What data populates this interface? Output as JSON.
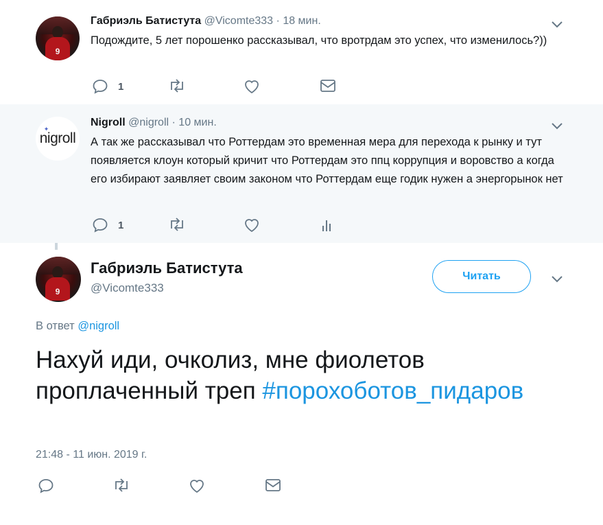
{
  "thread": [
    {
      "author_name": "Габриэль Батистута",
      "author_handle": "@Vicomte333",
      "separator": "·",
      "time_ago": "18 мин.",
      "text": "Подождите, 5 лет порошенко рассказывал, что вротрдам это успех, что изменилось?))",
      "reply_count": "1",
      "avatar_icon": "player-photo-avatar"
    },
    {
      "author_name": "Nigroll",
      "author_handle": "@nigroll",
      "separator": "·",
      "time_ago": "10 мин.",
      "text": "А так же рассказывал что Роттердам это временная мера для перехода к рынку и тут появляется клоун который кричит что Роттердам это ппц коррупция и воровство а когда его избирают заявляет своим законом что Роттердам еще годик нужен а энергорынок нет",
      "reply_count": "1",
      "avatar_logo_text": "nigroll"
    }
  ],
  "main_tweet": {
    "author_name": "Габриэль Батистута",
    "author_handle": "@Vicomte333",
    "follow_label": "Читать",
    "reply_prefix": "В ответ",
    "reply_handle": "@nigroll",
    "text": "Нахуй иди, очколиз, мне фиолетов проплаченный треп",
    "hashtag": "#порохоботов_пидаров",
    "timestamp": "21:48 - 11 июн. 2019 г."
  },
  "colors": {
    "accent": "#1da1f2",
    "link": "#1b95e0",
    "muted": "#657786",
    "thread_line": "#ccd6dd",
    "highlight_bg": "#f5f8fa"
  }
}
